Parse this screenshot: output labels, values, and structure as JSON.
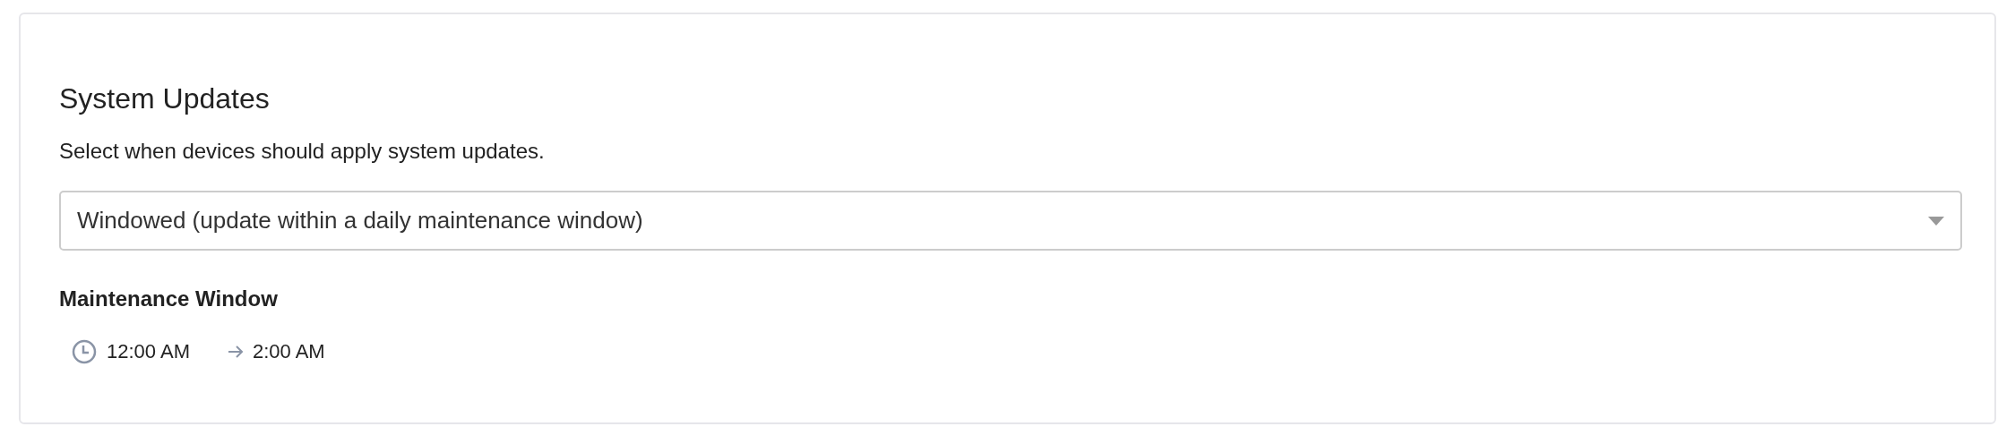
{
  "card": {
    "title": "System Updates",
    "description": "Select when devices should apply system updates.",
    "select": {
      "value": "Windowed (update within a daily maintenance window)"
    },
    "maintenance_window": {
      "label": "Maintenance Window",
      "start": "12:00 AM",
      "end": "2:00 AM"
    }
  }
}
